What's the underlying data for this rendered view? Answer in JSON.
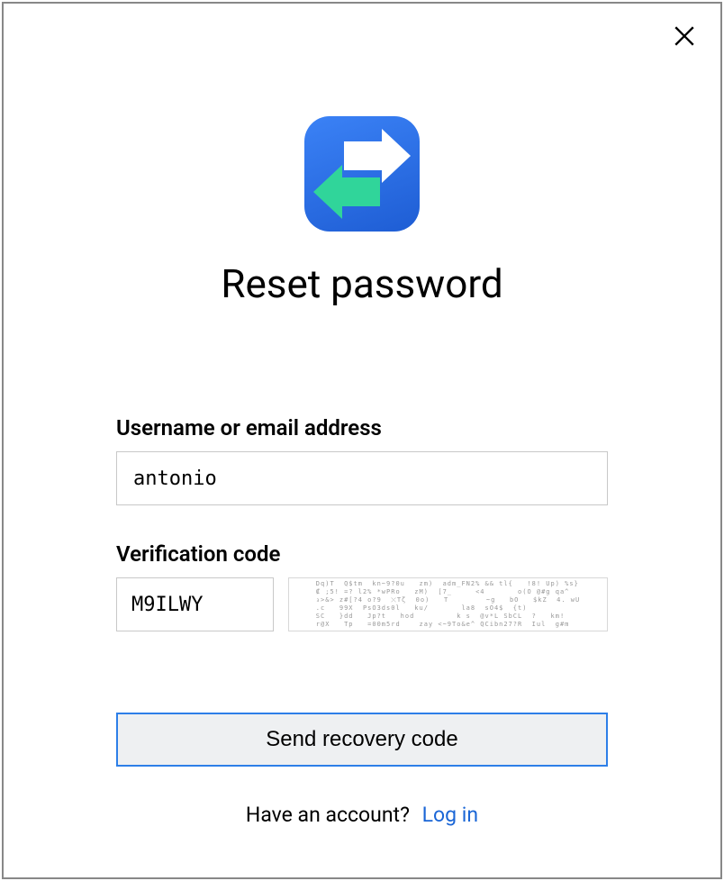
{
  "header": {
    "title": "Reset password"
  },
  "form": {
    "username_label": "Username or email address",
    "username_value": "antonio",
    "verification_label": "Verification code",
    "verification_value": "M9ILWY",
    "captcha_ascii": "Dq)T  Q$tm  kn~9?0u   zm)  adm_FN2% && tl{   !8! Up) %s}\n₡ ;5! =? l2% *wPRo   zM)  [7_     <4       o(O @#g qa^\n₃>&> z#[?4 o?9  ⤬Tζ  0o)   T        ~g   bO   $kZ  4. wU\n.c   99X  PsO3ds0l   ku/       la8  sO4$  {t)\nSC   }dd   Jp?t   hod         k s  @v*L SbCL  ?   km!\nr@X   Tp   =00m5rd    zay <~9To&e^ QCibn27?R  Iul  g#m"
  },
  "actions": {
    "submit_label": "Send recovery code"
  },
  "footer": {
    "prompt": "Have an account?",
    "link_label": "Log in"
  },
  "colors": {
    "accent_blue": "#2d7fe8",
    "link_blue": "#1a66d6",
    "logo_start": "#3b82f6",
    "logo_end": "#1e5dd4",
    "logo_arrow_green": "#30d59a"
  }
}
